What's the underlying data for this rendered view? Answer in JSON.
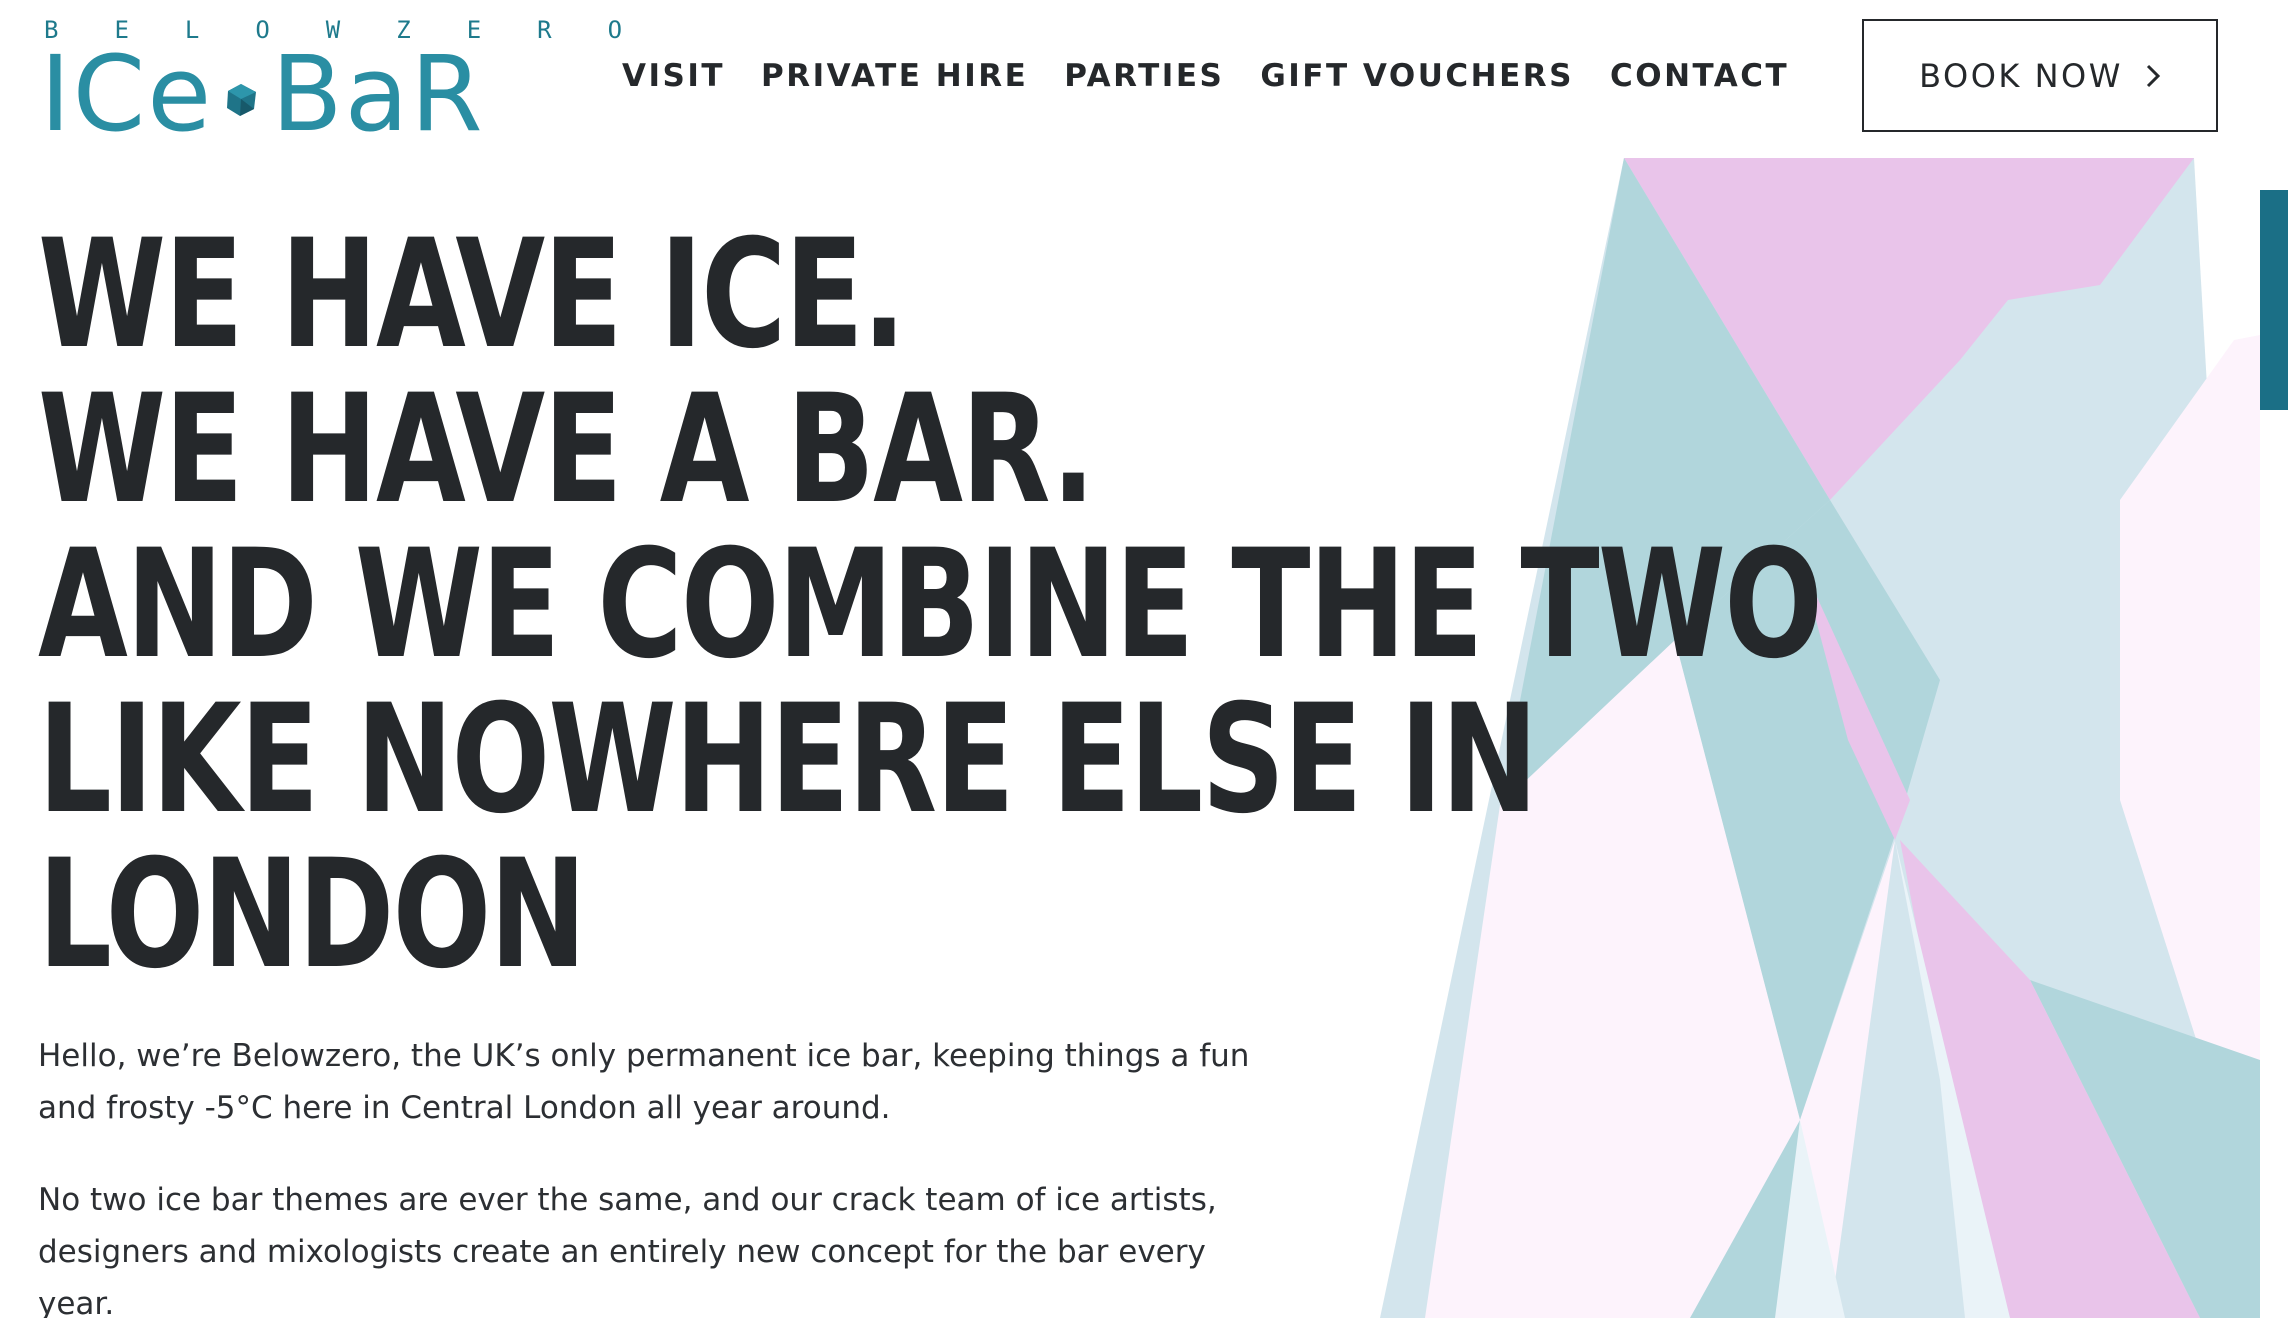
{
  "header": {
    "logo": {
      "tagline": "BELOWZERO",
      "name_left": "ICe",
      "name_right": "BaR"
    },
    "nav": [
      {
        "label": "VISIT"
      },
      {
        "label": "PRIVATE HIRE"
      },
      {
        "label": "PARTIES"
      },
      {
        "label": "GIFT VOUCHERS"
      },
      {
        "label": "CONTACT"
      }
    ],
    "cta_label": "BOOK NOW"
  },
  "hero": {
    "headline_lines": [
      "WE HAVE ICE.",
      "WE HAVE A BAR.",
      "AND WE COMBINE THE TWO",
      "LIKE NOWHERE ELSE IN",
      "LONDON"
    ],
    "paragraphs": [
      "Hello, we’re Belowzero, the UK’s only permanent ice bar, keeping things a fun and frosty -5°C here in Central London all year around.",
      "No two ice bar themes are ever the same, and our crack team of ice artists, designers and mixologists create an entirely new concept for the bar every year."
    ]
  },
  "colors": {
    "brand_teal": "#2a8ea3",
    "text_dark": "#25282b",
    "pink": "#e9c4ea",
    "light_pink": "#fdf3fc",
    "aqua": "#b1d6dc",
    "pale_blue": "#d3e5ed",
    "scroll_tab": "#1b6f86"
  },
  "icons": {
    "logo_gem": "ice-cube-icon",
    "cta": "chevron-right-icon"
  }
}
